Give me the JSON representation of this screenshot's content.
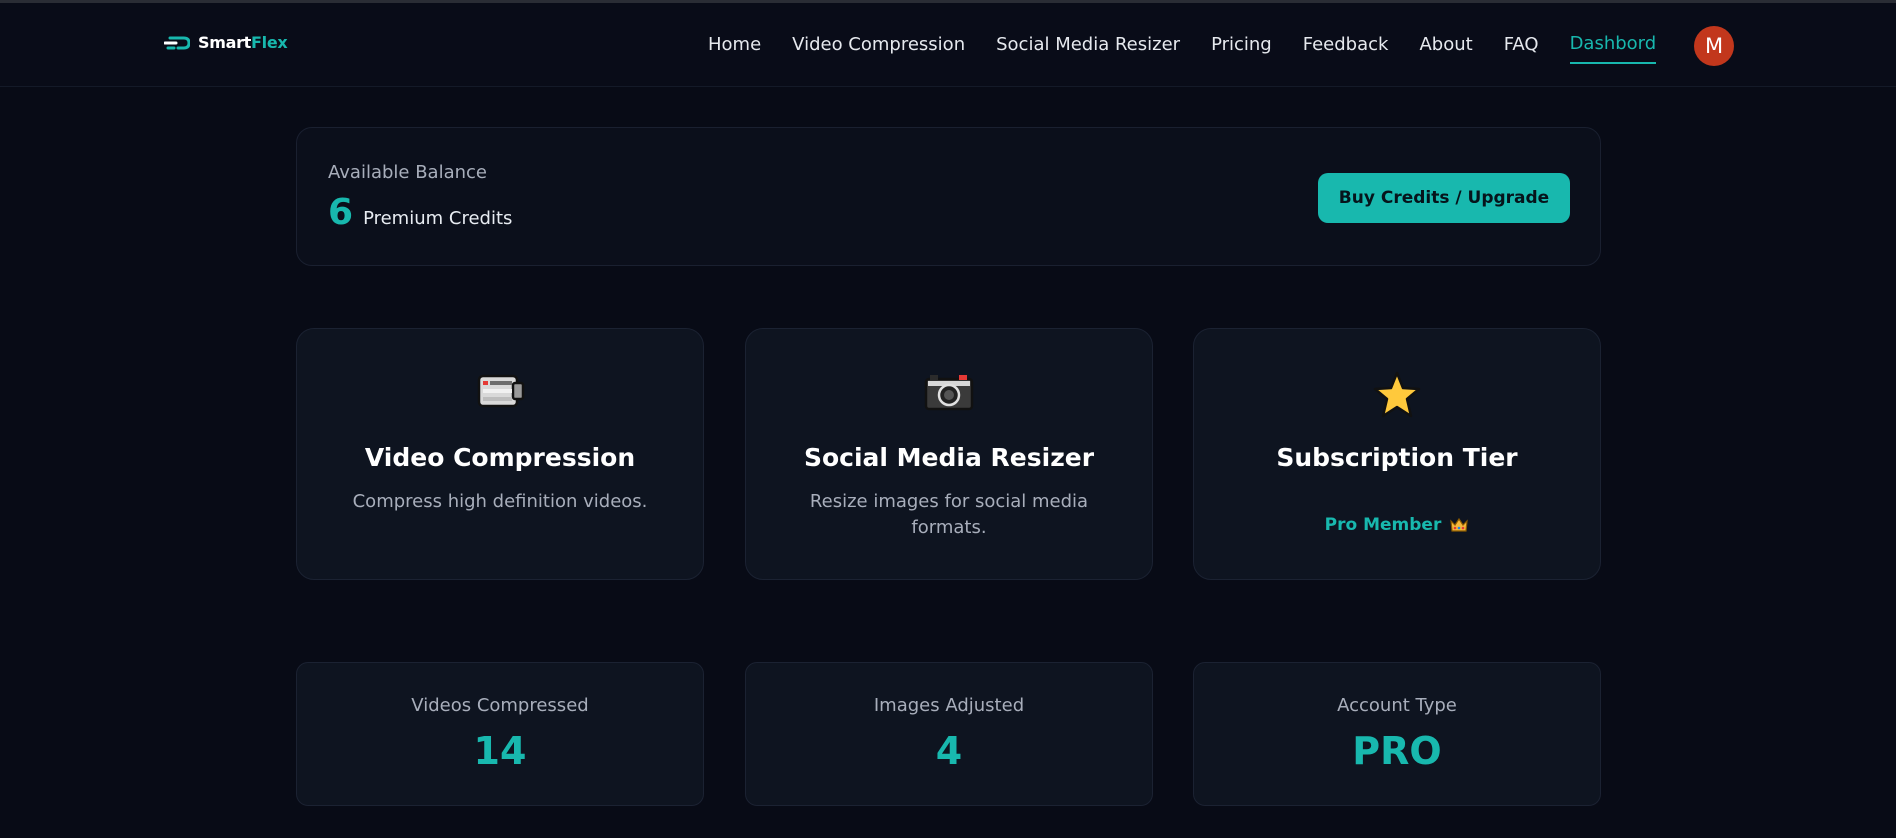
{
  "brand": {
    "name_part1": "Smart",
    "name_part2": "Flex"
  },
  "nav": {
    "links": [
      "Home",
      "Video Compression",
      "Social Media Resizer",
      "Pricing",
      "Feedback",
      "About",
      "FAQ",
      "Dashbord"
    ],
    "active": "Dashbord",
    "avatar_initial": "M"
  },
  "balance": {
    "label": "Available Balance",
    "value": "6",
    "unit": "Premium Credits",
    "button_label": "Buy Credits / Upgrade"
  },
  "features": [
    {
      "icon": "video-camera-icon",
      "title": "Video Compression",
      "description": "Compress high definition videos."
    },
    {
      "icon": "camera-icon",
      "title": "Social Media Resizer",
      "description": "Resize images for social media formats."
    },
    {
      "icon": "star-icon",
      "title": "Subscription Tier",
      "value": "Pro Member",
      "value_icon": "crown-icon"
    }
  ],
  "stats": [
    {
      "label": "Videos Compressed",
      "value": "14"
    },
    {
      "label": "Images Adjusted",
      "value": "4"
    },
    {
      "label": "Account Type",
      "value": "PRO"
    }
  ],
  "colors": {
    "background": "#080b16",
    "accent": "#18b8ae",
    "card": "#0e1420",
    "avatar": "#c2371c"
  }
}
